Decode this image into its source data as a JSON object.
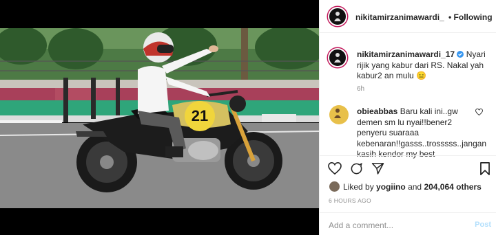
{
  "post": {
    "author": "nikitamirzanimawardi_",
    "follow_label": "Following",
    "separator": "•"
  },
  "caption": {
    "username": "nikitamirzanimawardi_17",
    "text": "Nyari rijik yang kabur dari RS. Nakal yah kabur2 an mulu",
    "emoji": "😑",
    "time": "6h"
  },
  "comment": {
    "username": "obieabbas",
    "text": "Baru kali ini..gw demen sm lu nyai!!bener2 penyeru suaraaa kebenaran!!gasss..trosssss..jangan kasih kendor my best"
  },
  "likes": {
    "prefix": "Liked by",
    "user": "yogiino",
    "and_label": "and",
    "count_text": "204,064 others"
  },
  "timestamp": "6 HOURS AGO",
  "add_comment": {
    "placeholder": "Add a comment...",
    "post_label": "Post"
  },
  "photo": {
    "plate_text": "21"
  },
  "colors": {
    "verified": "#3897f0",
    "link_disabled": "#b2dffc",
    "muted": "#8e8e8e",
    "text": "#262626"
  }
}
